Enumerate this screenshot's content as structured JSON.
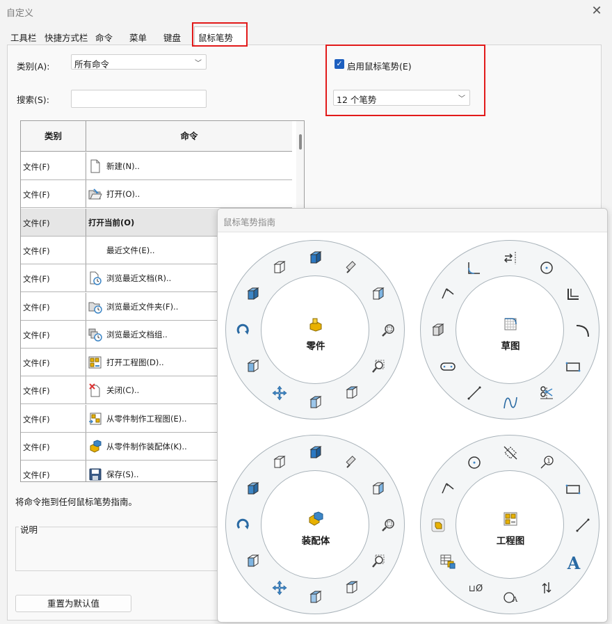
{
  "window": {
    "title": "自定义",
    "close_label": "✕"
  },
  "tabs": [
    "工具栏",
    "快捷方式栏",
    "命令",
    "菜单",
    "键盘",
    "鼠标笔势"
  ],
  "active_tab": "鼠标笔势",
  "category": {
    "label": "类别(A):",
    "value": "所有命令"
  },
  "search": {
    "label": "搜索(S):",
    "value": ""
  },
  "table": {
    "headers": {
      "category": "类别",
      "command": "命令"
    },
    "rows": [
      {
        "category": "文件(F)",
        "command": "新建(N)..",
        "icon": "new-document-icon"
      },
      {
        "category": "文件(F)",
        "command": "打开(O)..",
        "icon": "open-folder-icon"
      },
      {
        "category": "文件(F)",
        "command": "打开当前(O)",
        "icon": "",
        "bold": true
      },
      {
        "category": "文件(F)",
        "command": "最近文件(E)..",
        "icon": ""
      },
      {
        "category": "文件(F)",
        "command": "浏览最近文档(R)..",
        "icon": "recent-document-icon"
      },
      {
        "category": "文件(F)",
        "command": "浏览最近文件夹(F)..",
        "icon": "recent-folder-icon"
      },
      {
        "category": "文件(F)",
        "command": "浏览最近文档组..",
        "icon": "recent-group-icon"
      },
      {
        "category": "文件(F)",
        "command": "打开工程图(D)..",
        "icon": "open-drawing-icon"
      },
      {
        "category": "文件(F)",
        "command": "关闭(C)..",
        "icon": "close-file-icon"
      },
      {
        "category": "文件(F)",
        "command": "从零件制作工程图(E)..",
        "icon": "make-drawing-icon"
      },
      {
        "category": "文件(F)",
        "command": "从零件制作装配体(K)..",
        "icon": "make-assembly-icon"
      },
      {
        "category": "文件(F)",
        "command": "保存(S)..",
        "icon": "save-icon"
      }
    ]
  },
  "drag_hint": "将命令拖到任何鼠标笔势指南。",
  "description": {
    "label": "说明"
  },
  "reset_button": "重置为默认值",
  "gestures": {
    "enable_label": "启用鼠标笔势(E)",
    "enabled": true,
    "count_value": "12 个笔势"
  },
  "guide": {
    "title": "鼠标笔势指南",
    "wheels": [
      {
        "label": "零件",
        "center_icon": "part-icon",
        "icons": [
          "isometric-view-icon",
          "front-view-icon",
          "shaded-view-icon",
          "zoom-to-fit-icon",
          "right-view-icon",
          "zoom-to-area-icon",
          "zoom-area-icon",
          "top-view-icon",
          "back-view-icon",
          "move-icon",
          "left-view-icon",
          "rotate-icon"
        ]
      },
      {
        "label": "草图",
        "center_icon": "sketch-icon",
        "icons": [
          "smart-dimension-icon",
          "fillet-icon",
          "mirror-entities-icon",
          "circle-icon",
          "offset-entities-icon",
          "arc-icon",
          "rectangle-icon",
          "trim-entities-icon",
          "spline-icon",
          "line-icon",
          "slot-icon",
          "shaded-box-icon"
        ]
      },
      {
        "label": "装配体",
        "center_icon": "assembly-icon",
        "icons": [
          "isometric-view-icon",
          "front-view-icon",
          "shaded-view-icon",
          "zoom-to-fit-icon",
          "right-view-icon",
          "zoom-to-area-icon",
          "zoom-area-icon",
          "top-view-icon",
          "back-view-icon",
          "move-icon",
          "left-view-icon",
          "rotate-icon"
        ]
      },
      {
        "label": "工程图",
        "center_icon": "drawing-icon",
        "icons": [
          "smart-dimension-icon",
          "circle-icon",
          "section-view-icon",
          "balloon-icon",
          "rectangle-icon",
          "line-icon",
          "note-icon",
          "swap-icon",
          "center-mark-icon",
          "datum-symbol-icon",
          "bom-table-icon",
          "part-in-drawing-icon"
        ]
      }
    ],
    "text_glyphs": {
      "note": "A",
      "datum": "⊔Ø",
      "balloon": "1"
    }
  },
  "colors": {
    "accent": "#1d5fbf",
    "highlight_red": "#e21a1a",
    "icon_blue": "#3d86c6",
    "icon_gold": "#e8b100"
  }
}
